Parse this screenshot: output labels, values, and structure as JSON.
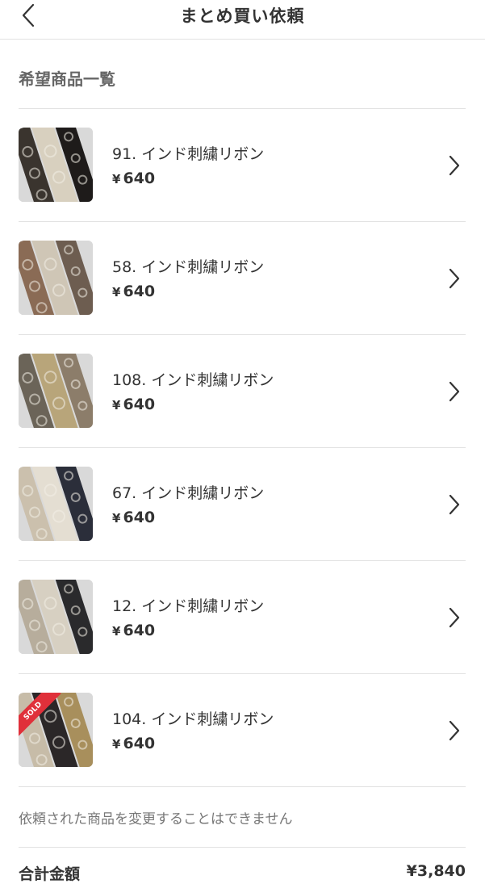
{
  "header": {
    "title": "まとめ買い依頼",
    "back_icon": "chevron-left-icon"
  },
  "section": {
    "title": "希望商品一覧"
  },
  "items": [
    {
      "name": "91. インド刺繍リボン",
      "currency": "¥",
      "price": "640",
      "palette": [
        "#3a342e",
        "#d8d0bf",
        "#1e1b1a"
      ],
      "sold": false
    },
    {
      "name": "58. インド刺繍リボン",
      "currency": "¥",
      "price": "640",
      "palette": [
        "#8a6b55",
        "#cfc6b6",
        "#6d5d50"
      ],
      "sold": false
    },
    {
      "name": "108. インド刺繍リボン",
      "currency": "¥",
      "price": "640",
      "palette": [
        "#6b6458",
        "#b8a57a",
        "#8c7d6a"
      ],
      "sold": false
    },
    {
      "name": "67. インド刺繍リボン",
      "currency": "¥",
      "price": "640",
      "palette": [
        "#cbc0ad",
        "#e4ded2",
        "#2b2e3a"
      ],
      "sold": false
    },
    {
      "name": "12. インド刺繍リボン",
      "currency": "¥",
      "price": "640",
      "palette": [
        "#b7ad9c",
        "#d7d0c2",
        "#2a2a2c"
      ],
      "sold": false
    },
    {
      "name": "104. インド刺繍リボン",
      "currency": "¥",
      "price": "640",
      "palette": [
        "#c7bca8",
        "#2b2728",
        "#a88f5c"
      ],
      "sold": true,
      "sold_label": "SOLD"
    }
  ],
  "note": "依頼された商品を変更することはできません",
  "footer": {
    "total_label": "合計金額",
    "total_value": "¥3,840"
  },
  "colors": {
    "divider": "#e2e2e2",
    "sold_badge": "#e0303a",
    "text": "#333333",
    "muted": "#777777"
  }
}
